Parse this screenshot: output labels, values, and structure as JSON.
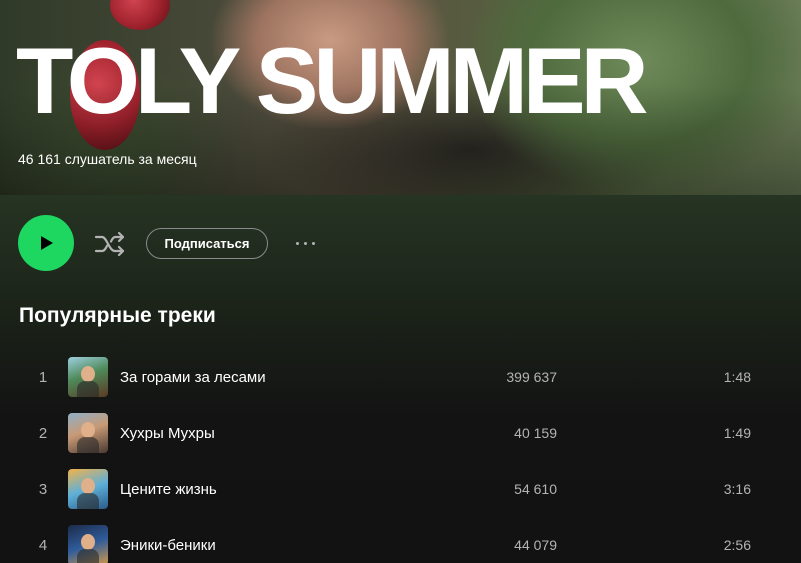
{
  "artist": {
    "name": "TOLY SUMMER",
    "monthly_listeners": "46 161 слушатель за месяц"
  },
  "actions": {
    "play_icon": "play-icon",
    "shuffle_icon": "shuffle-icon",
    "follow_label": "Подписаться",
    "more_icon": "more-options-icon",
    "play_button_color": "#1ed760"
  },
  "popular": {
    "title": "Популярные треки",
    "tracks": [
      {
        "number": "1",
        "title": "За горами за лесами",
        "plays": "399 637",
        "duration": "1:48"
      },
      {
        "number": "2",
        "title": "Хухры Мухры",
        "plays": "40 159",
        "duration": "1:49"
      },
      {
        "number": "3",
        "title": "Цените жизнь",
        "plays": "54 610",
        "duration": "3:16"
      },
      {
        "number": "4",
        "title": "Эники-беники",
        "plays": "44 079",
        "duration": "2:56"
      }
    ]
  }
}
